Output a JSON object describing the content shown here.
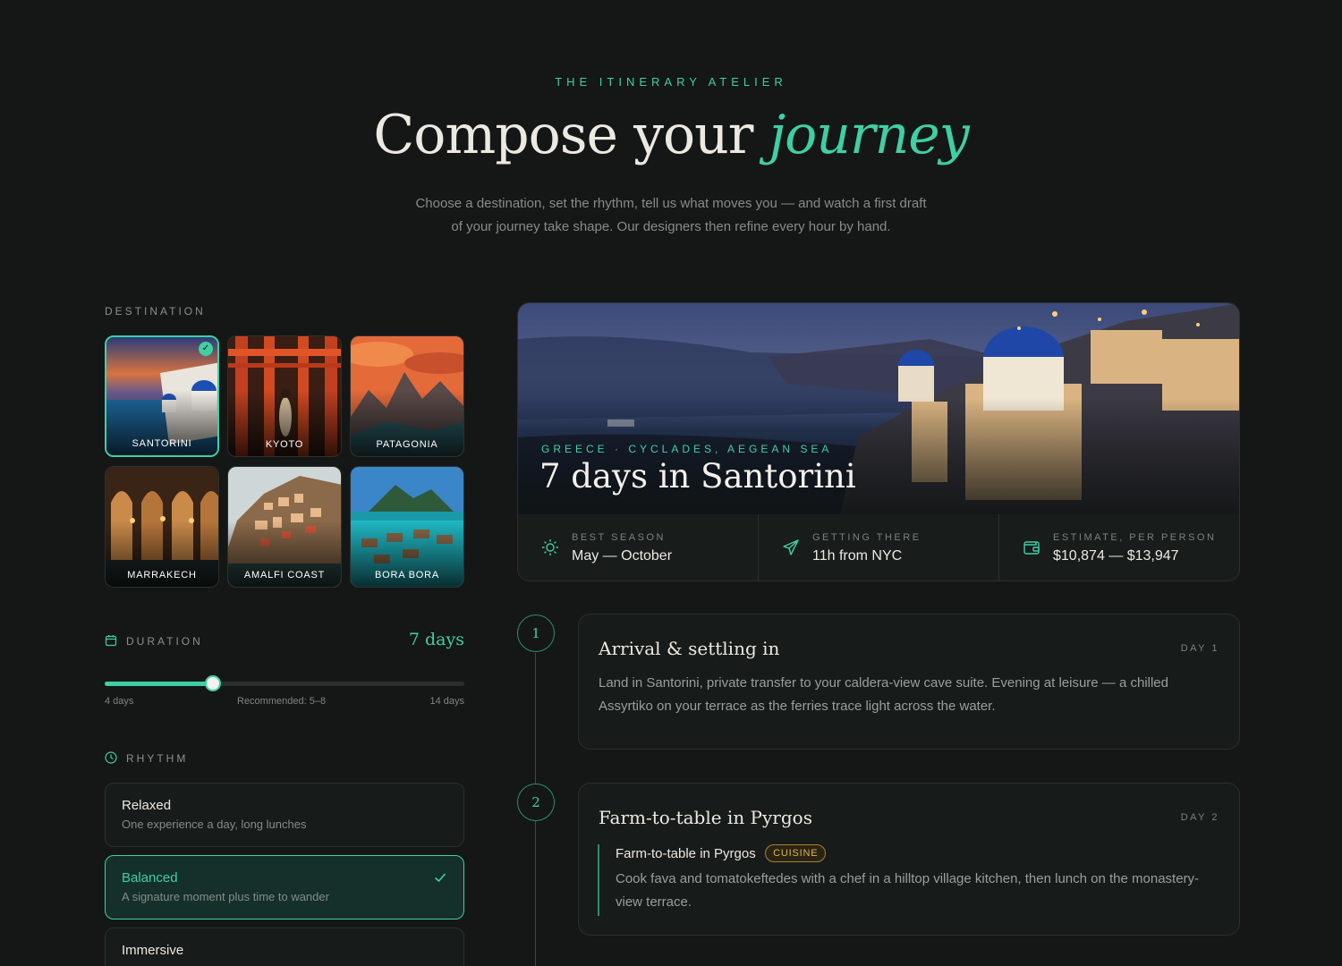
{
  "header": {
    "eyebrow": "THE ITINERARY ATELIER",
    "title_main": "Compose your",
    "title_accent": "journey",
    "subtitle_line1": "Choose a destination, set the rhythm, tell us what moves you — and watch a first draft",
    "subtitle_line2": "of your journey take shape. Our designers then refine every hour by hand."
  },
  "destination": {
    "label": "DESTINATION",
    "tiles": [
      {
        "name": "SANTORINI",
        "selected": true,
        "icon": "check-icon"
      },
      {
        "name": "KYOTO",
        "selected": false
      },
      {
        "name": "PATAGONIA",
        "selected": false
      },
      {
        "name": "MARRAKECH",
        "selected": false
      },
      {
        "name": "AMALFI COAST",
        "selected": false
      },
      {
        "name": "BORA BORA",
        "selected": false
      }
    ]
  },
  "duration": {
    "label": "DURATION",
    "icon": "calendar-icon",
    "value_text": "7 days",
    "min_label": "4 days",
    "recommended_label": "Recommended: 5–8",
    "max_label": "14 days",
    "slider_fraction": 0.3
  },
  "rhythm": {
    "label": "RHYTHM",
    "icon": "clock-icon",
    "options": [
      {
        "title": "Relaxed",
        "desc": "One experience a day, long lunches",
        "selected": false
      },
      {
        "title": "Balanced",
        "desc": "A signature moment plus time to wander",
        "selected": true
      },
      {
        "title": "Immersive",
        "desc": "",
        "selected": false
      }
    ]
  },
  "feature": {
    "eyebrow": "GREECE · CYCLADES, AEGEAN SEA",
    "title": "7 days in Santorini",
    "stats": [
      {
        "label": "BEST SEASON",
        "value": "May — October",
        "icon": "sun-icon"
      },
      {
        "label": "GETTING THERE",
        "value": "11h from NYC",
        "icon": "plane-icon"
      },
      {
        "label": "ESTIMATE, PER PERSON",
        "value": "$10,874 — $13,947",
        "icon": "wallet-icon"
      }
    ]
  },
  "itinerary": {
    "days": [
      {
        "number": "1",
        "title": "Arrival & settling in",
        "tag": "DAY 1",
        "body": "Land in Santorini, private transfer to your caldera-view cave suite. Evening at leisure — a chilled Assyrtiko on your terrace as the ferries trace light across the water."
      },
      {
        "number": "2",
        "title": "Farm-to-table in Pyrgos",
        "tag": "DAY 2",
        "activity_title": "Farm-to-table in Pyrgos",
        "activity_badge": "CUISINE",
        "activity_body": "Cook fava and tomatokeftedes with a chef in a hilltop village kitchen, then lunch on the monastery-view terrace."
      }
    ]
  },
  "colors": {
    "accent": "#3fcfa4",
    "background": "#141716",
    "badge_gold": "#e0b24b"
  }
}
